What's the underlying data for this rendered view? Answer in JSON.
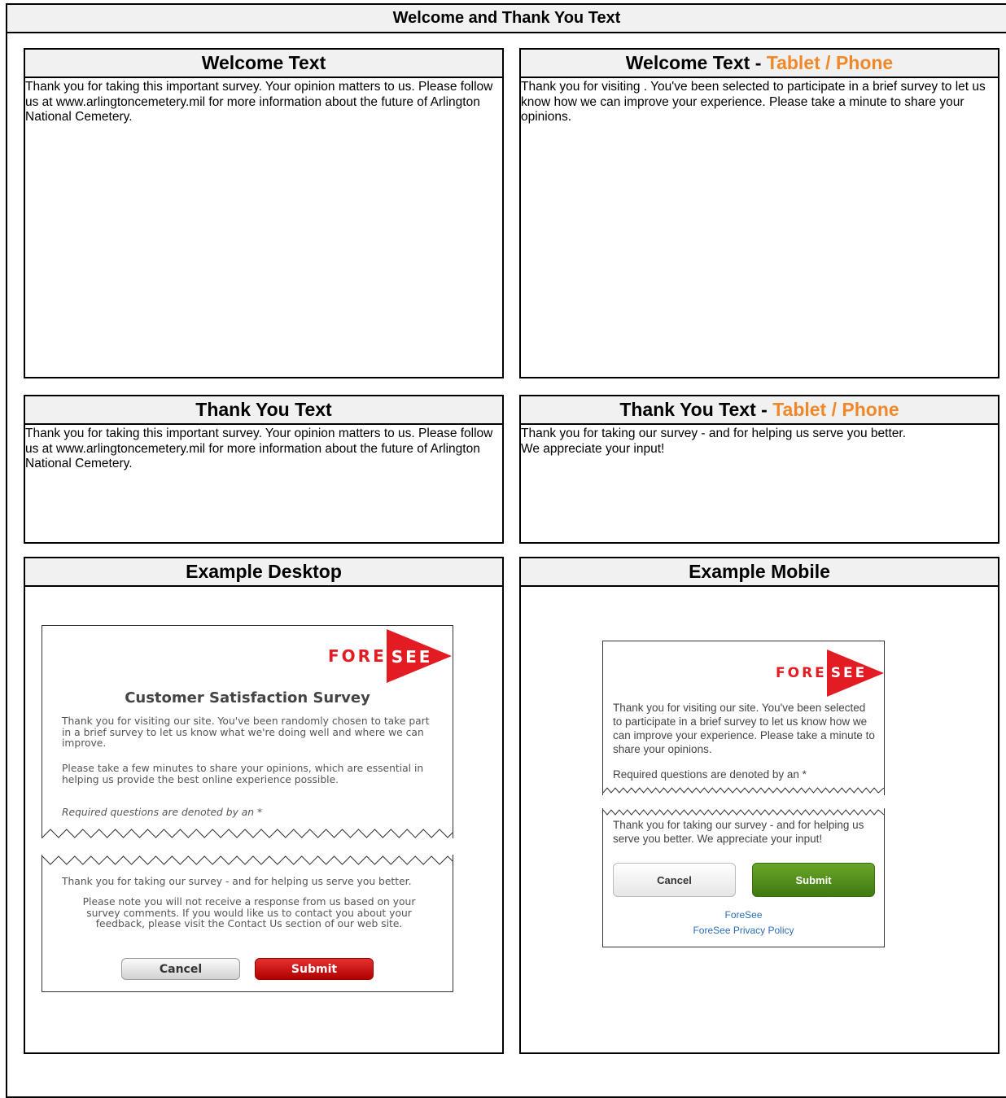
{
  "header": {
    "title": "Welcome and Thank You Text"
  },
  "welcome": {
    "title": "Welcome Text",
    "body": "Thank you for taking this important survey. Your opinion matters to us. Please follow us at www.arlingtoncemetery.mil for more information about the future of Arlington National Cemetery."
  },
  "welcome_mobile": {
    "title_prefix": "Welcome Text - ",
    "title_accent": "Tablet / Phone",
    "body": "Thank you for visiting . You've been selected to participate in a brief survey to let us know how we can improve your experience. Please take a minute to share your opinions."
  },
  "thanks": {
    "title": "Thank You Text",
    "body": "Thank you for taking this important survey. Your opinion matters to us. Please follow us at www.arlingtoncemetery.mil for more information about the future of Arlington National Cemetery."
  },
  "thanks_mobile": {
    "title_prefix": "Thank You Text - ",
    "title_accent": "Tablet / Phone",
    "body": "Thank you for taking our survey - and for helping us serve you better.\nWe appreciate your input!"
  },
  "example_desktop": {
    "title": "Example Desktop",
    "logo_left": "FORE",
    "logo_right": "SEE",
    "survey_title": "Customer Satisfaction Survey",
    "para1": "Thank you for visiting our site. You've been randomly chosen to take part in a brief survey to let us know what we're doing well and where we can improve.",
    "para2": "Please take a few minutes to share your opinions, which are essential in helping us provide the best online experience possible.",
    "required": "Required questions are denoted by an *",
    "thanks1": "Thank you for taking our survey - and for helping us serve you better.",
    "thanks2": "Please note you will not receive a response from us based on your survey comments. If you would like us to contact you about your feedback, please visit the Contact Us section of our web site.",
    "cancel": "Cancel",
    "submit": "Submit"
  },
  "example_mobile": {
    "title": "Example Mobile",
    "logo_left": "FORE",
    "logo_right": "SEE",
    "para1": "Thank you for visiting our site. You've been selected to participate in a brief survey to let us know how we can improve your experience. Please take a minute to share your opinions.",
    "required": "Required questions are denoted by an *",
    "thanks": "Thank you for taking our survey - and for helping us serve you better. We appreciate your input!",
    "cancel": "Cancel",
    "submit": "Submit",
    "link1": "ForeSee",
    "link2": "ForeSee Privacy Policy"
  },
  "colors": {
    "accent": "#f0882a",
    "brand_red": "#e31b23",
    "submit_green": "#4a8a17"
  }
}
